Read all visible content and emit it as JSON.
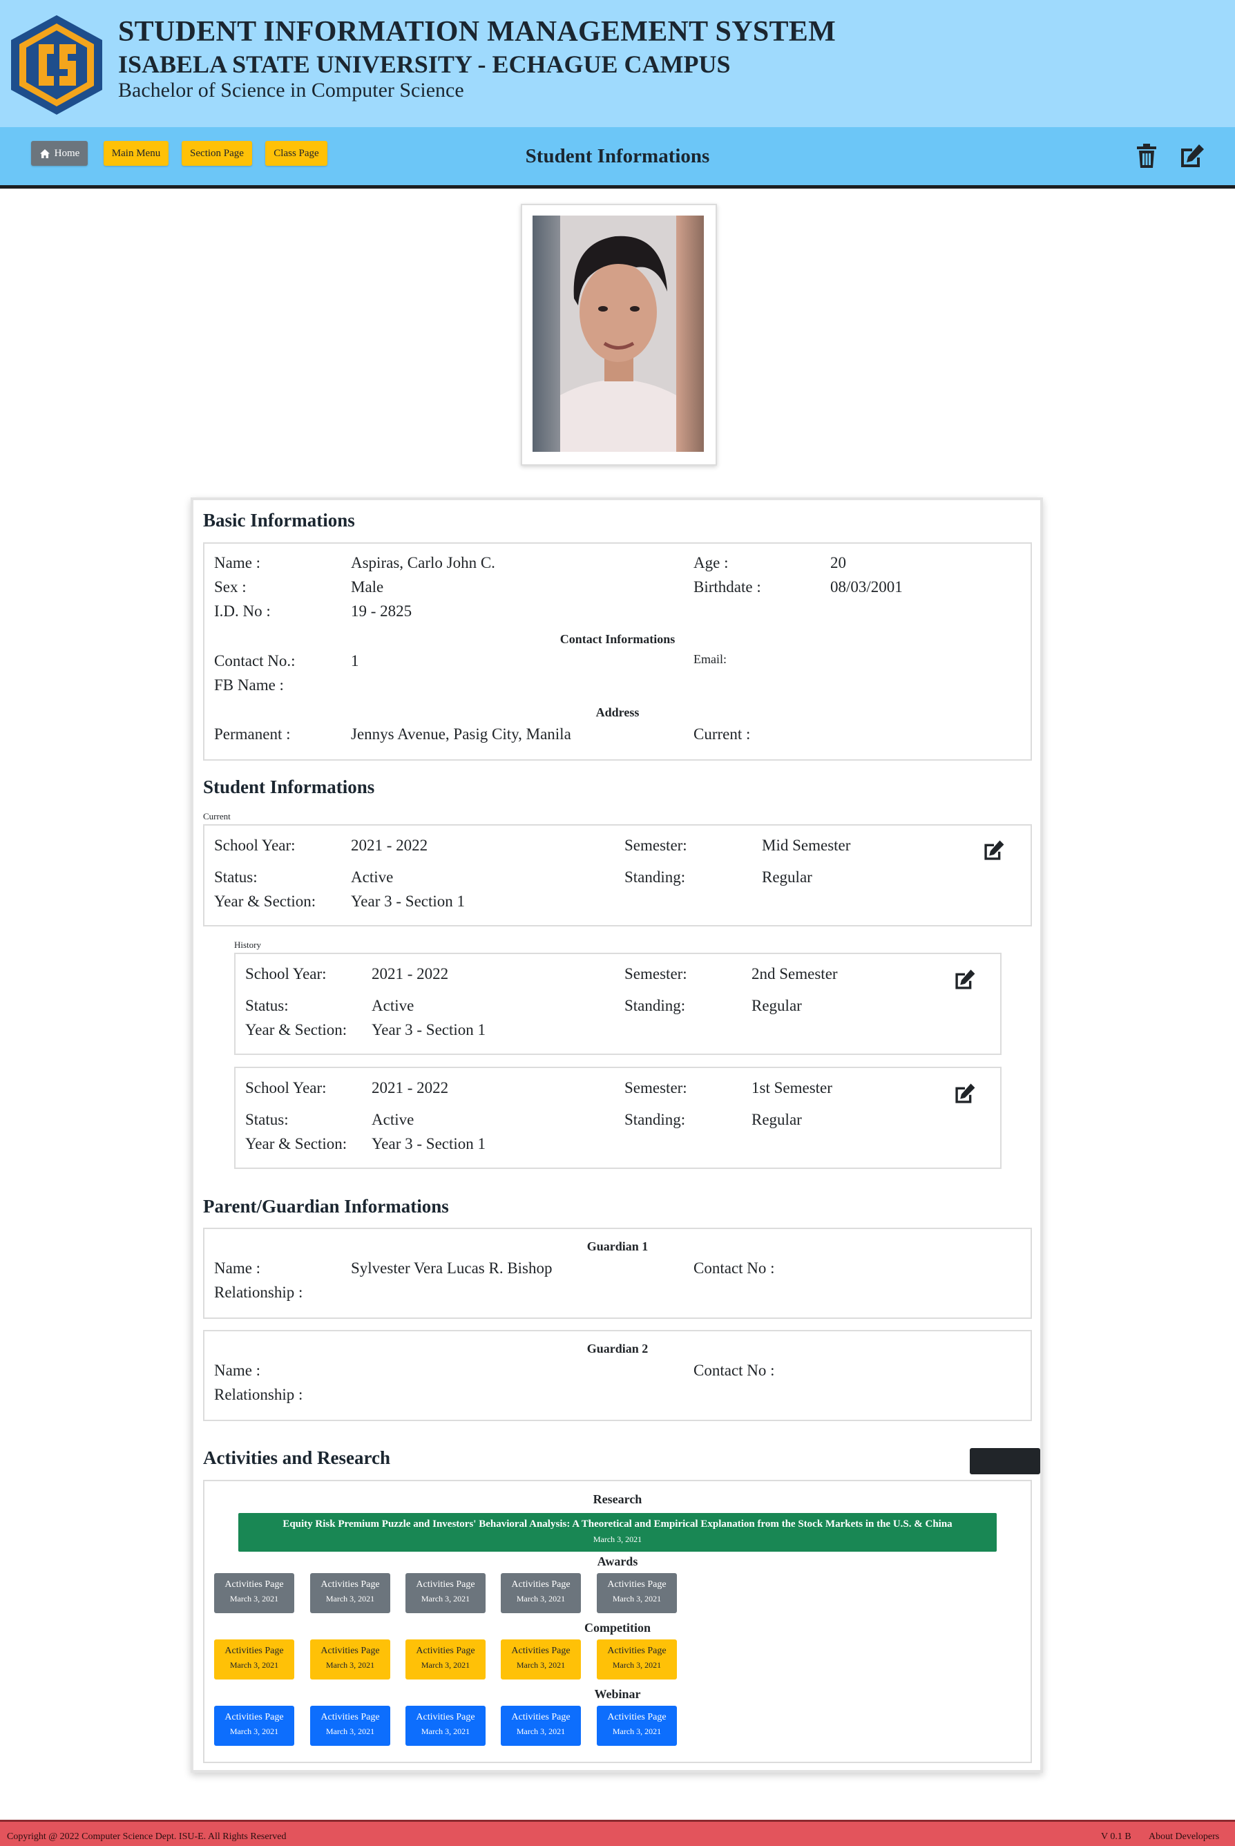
{
  "header": {
    "system_title": "STUDENT INFORMATION MANAGEMENT SYSTEM",
    "university": "ISABELA STATE UNIVERSITY - ECHAGUE CAMPUS",
    "program": "Bachelor of Science in Computer Science",
    "logo_icon": "cs-hexagon-logo"
  },
  "nav": {
    "home_label": "Home",
    "main_menu_label": "Main Menu",
    "section_page_label": "Section Page",
    "class_page_label": "Class Page",
    "page_title": "Student Informations",
    "delete_icon": "trash-icon",
    "edit_icon": "edit-icon"
  },
  "basic": {
    "heading": "Basic Informations",
    "name_label": "Name :",
    "name_value": "Aspiras, Carlo John C.",
    "sex_label": "Sex :",
    "sex_value": "Male",
    "id_label": "I.D. No :",
    "id_value": "19 - 2825",
    "age_label": "Age :",
    "age_value": "20",
    "birthdate_label": "Birthdate :",
    "birthdate_value": "08/03/2001",
    "contact_heading": "Contact Informations",
    "contact_label": "Contact No.:",
    "contact_value": "1",
    "fb_label": "FB Name :",
    "email_label": "Email:",
    "address_heading": "Address",
    "permanent_label": "Permanent :",
    "permanent_value": "Jennys Avenue, Pasig City, Manila",
    "current_label": "Current :"
  },
  "student": {
    "heading": "Student Informations",
    "current_caption": "Current",
    "history_caption": "History",
    "labels": {
      "school_year": "School Year:",
      "semester": "Semester:",
      "status": "Status:",
      "standing": "Standing:",
      "year_section": "Year & Section:"
    },
    "current": {
      "school_year": "2021 - 2022",
      "semester": "Mid Semester",
      "status": "Active",
      "standing": "Regular",
      "year_section": "Year 3 - Section 1"
    },
    "history": [
      {
        "school_year": "2021 - 2022",
        "semester": "2nd Semester",
        "status": "Active",
        "standing": "Regular",
        "year_section": "Year 3 - Section 1"
      },
      {
        "school_year": "2021 - 2022",
        "semester": "1st Semester",
        "status": "Active",
        "standing": "Regular",
        "year_section": "Year 3 - Section 1"
      }
    ]
  },
  "guardian": {
    "heading": "Parent/Guardian Informations",
    "name_label": "Name :",
    "relationship_label": "Relationship :",
    "contact_label": "Contact No :",
    "g1": {
      "title": "Guardian 1",
      "name": "Sylvester Vera Lucas R. Bishop"
    },
    "g2": {
      "title": "Guardian 2",
      "name": ""
    }
  },
  "activities": {
    "heading": "Activities and Research",
    "research_heading": "Research",
    "research_title": "Equity Risk Premium Puzzle and Investors' Behavioral Analysis: A Theoretical and Empirical Explanation from the Stock Markets in the U.S. & China",
    "research_date": "March 3, 2021",
    "awards_heading": "Awards",
    "competition_heading": "Competition",
    "webinar_heading": "Webinar",
    "item_label": "Activities Page",
    "item_date": "March 3, 2021"
  },
  "colors": {
    "banner": "#9fdafd",
    "navbar": "#6cc6f7",
    "footer": "#e3545c",
    "research": "#198754",
    "awards": "#6c757d",
    "competition": "#ffc107",
    "webinar": "#0d6efd"
  },
  "footer": {
    "copyright": "Copyright @ 2022 Computer Science Dept. ISU-E. All Rights Reserved",
    "version": "V 0.1 B",
    "about": "About Developers"
  }
}
